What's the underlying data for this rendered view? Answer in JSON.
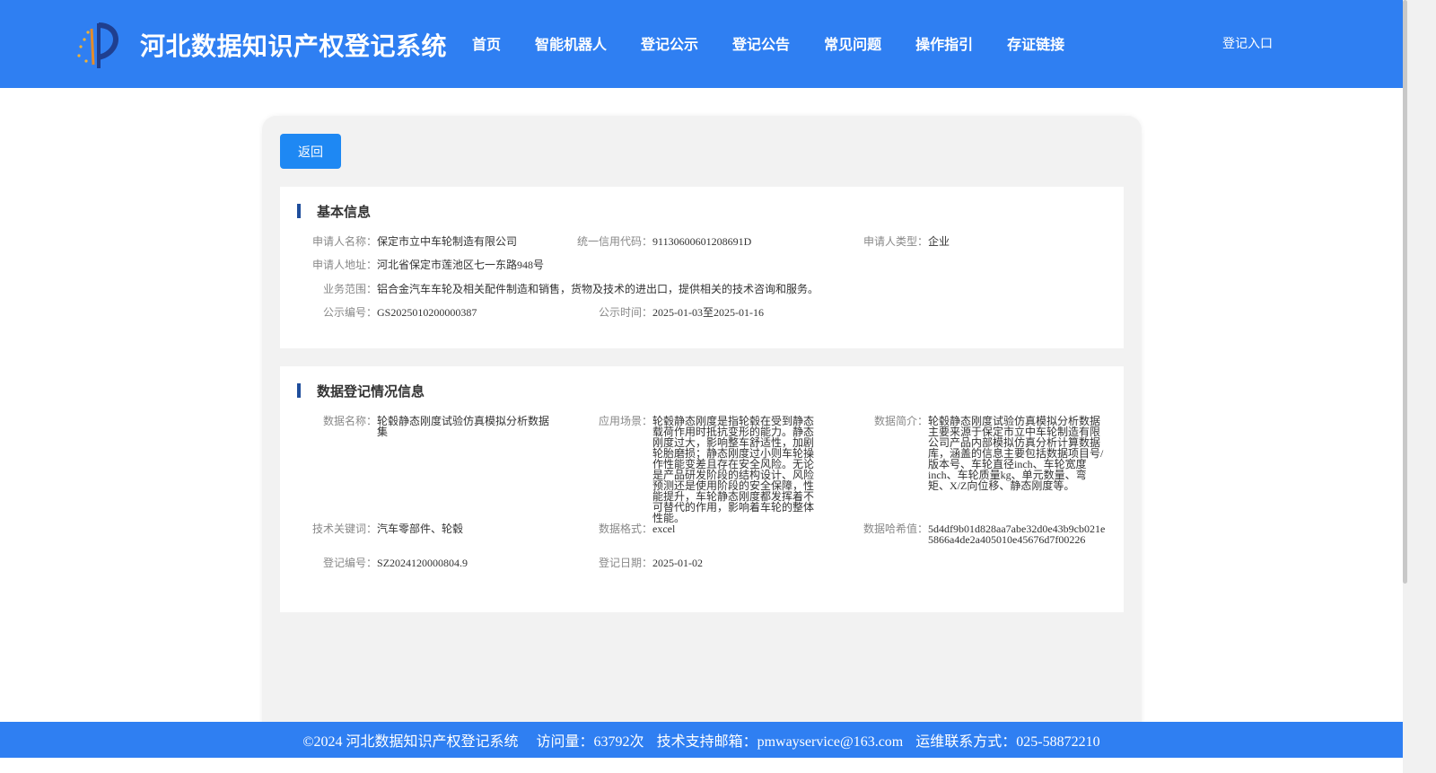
{
  "header": {
    "title": "河北数据知识产权登记系统",
    "nav": [
      "首页",
      "智能机器人",
      "登记公示",
      "登记公告",
      "常见问题",
      "操作指引",
      "存证链接"
    ],
    "login": "登记入口"
  },
  "back_button": "返回",
  "basic": {
    "title": "基本信息",
    "applicant_name_label": "申请人名称：",
    "applicant_name": "保定市立中车轮制造有限公司",
    "credit_code_label": "统一信用代码：",
    "credit_code": "91130600601208691D",
    "applicant_type_label": "申请人类型：",
    "applicant_type": "企业",
    "address_label": "申请人地址：",
    "address": "河北省保定市莲池区七一东路948号",
    "scope_label": "业务范围：",
    "scope": "铝合金汽车车轮及相关配件制造和销售，货物及技术的进出口，提供相关的技术咨询和服务。",
    "notice_no_label": "公示编号：",
    "notice_no": "GS2025010200000387",
    "notice_time_label": "公示时间：",
    "notice_time": "2025-01-03至2025-01-16"
  },
  "data_info": {
    "title": "数据登记情况信息",
    "data_name_label": "数据名称：",
    "data_name": "轮毂静态刚度试验仿真模拟分析数据集",
    "scenario_label": "应用场景：",
    "scenario": "轮毂静态刚度是指轮毂在受到静态载荷作用时抵抗变形的能力。静态刚度过大，影响整车舒适性，加剧轮胎磨损；静态刚度过小则车轮操作性能变差且存在安全风险。无论是产品研发阶段的结构设计、风险预测还是使用阶段的安全保障，性能提升，车轮静态刚度都发挥着不可替代的作用，影响着车轮的整体性能。",
    "summary_label": "数据简介：",
    "summary": "轮毂静态刚度试验仿真模拟分析数据主要来源于保定市立中车轮制造有限公司产品内部模拟仿真分析计算数据库，涵盖的信息主要包括数据项目号/版本号、车轮直径inch、车轮宽度inch、车轮质量kg、单元数量、弯矩、X/Z向位移、静态刚度等。",
    "keywords_label": "技术关键词：",
    "keywords": "汽车零部件、轮毂",
    "format_label": "数据格式：",
    "format": "excel",
    "hash_label": "数据哈希值：",
    "hash": "5d4df9b01d828aa7abe32d0e43b9cb021e5866a4de2a405010e45676d7f00226",
    "reg_no_label": "登记编号：",
    "reg_no": "SZ2024120000804.9",
    "reg_date_label": "登记日期：",
    "reg_date": "2025-01-02"
  },
  "footer": {
    "copyright": "©2024 河北数据知识产权登记系统",
    "visits": "访问量：63792次",
    "support": "技术支持邮箱：pmwayservice@163.com",
    "contact": "运维联系方式：025-58872210"
  }
}
